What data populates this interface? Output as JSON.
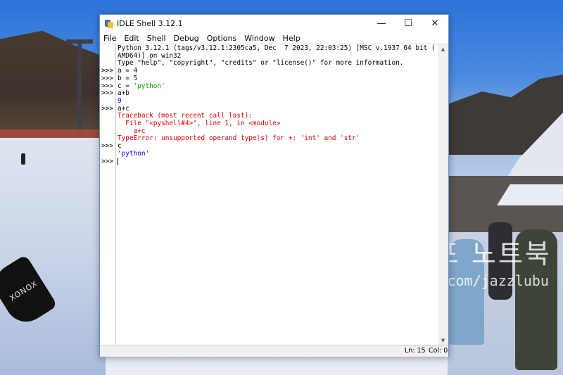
{
  "window": {
    "title": "IDLE Shell 3.12.1",
    "icon": "idle-python-icon",
    "controls": {
      "minimize": "—",
      "maximize": "☐",
      "close": "✕"
    }
  },
  "menubar": {
    "items": [
      {
        "label": "File"
      },
      {
        "label": "Edit"
      },
      {
        "label": "Shell"
      },
      {
        "label": "Debug"
      },
      {
        "label": "Options"
      },
      {
        "label": "Window"
      },
      {
        "label": "Help"
      }
    ]
  },
  "shell": {
    "prompt": ">>>",
    "banner": [
      "Python 3.12.1 (tags/v3.12.1:2305ca5, Dec  7 2023, 22:03:25) [MSC v.1937 64 bit (",
      "AMD64)] on win32",
      "Type \"help\", \"copyright\", \"credits\" or \"license()\" for more information."
    ],
    "lines": [
      {
        "prompt": true,
        "text": "a = 4",
        "style": "input"
      },
      {
        "prompt": true,
        "text": "b = 5",
        "style": "input"
      },
      {
        "prompt": true,
        "text": "c = ",
        "string": "'python'",
        "style": "input"
      },
      {
        "prompt": true,
        "text": "a+b",
        "style": "input"
      },
      {
        "prompt": false,
        "text": "9",
        "style": "output"
      },
      {
        "prompt": true,
        "text": "a+c",
        "style": "input"
      },
      {
        "prompt": false,
        "text": "Traceback (most recent call last):",
        "style": "error"
      },
      {
        "prompt": false,
        "text": "  File \"<pyshell#4>\", line 1, in <module>",
        "style": "error"
      },
      {
        "prompt": false,
        "text": "    a+c",
        "style": "error"
      },
      {
        "prompt": false,
        "text": "TypeError: unsupported operand type(s) for +: 'int' and 'str'",
        "style": "error"
      },
      {
        "prompt": true,
        "text": "c",
        "style": "input"
      },
      {
        "prompt": false,
        "text": "'python'",
        "style": "output"
      },
      {
        "prompt": true,
        "text": "",
        "style": "input"
      }
    ]
  },
  "status": {
    "ln": "Ln: 15",
    "col": "Col: 0"
  },
  "background": {
    "watermark_line1": "진실여포 노트북",
    "watermark_line2": "blog.naver.com/jazzlubu",
    "board_text": "XONOX"
  },
  "colors": {
    "string": "#00aa00",
    "output": "#0000ff",
    "error": "#dd0000",
    "window_border": "#6d8fc6"
  }
}
